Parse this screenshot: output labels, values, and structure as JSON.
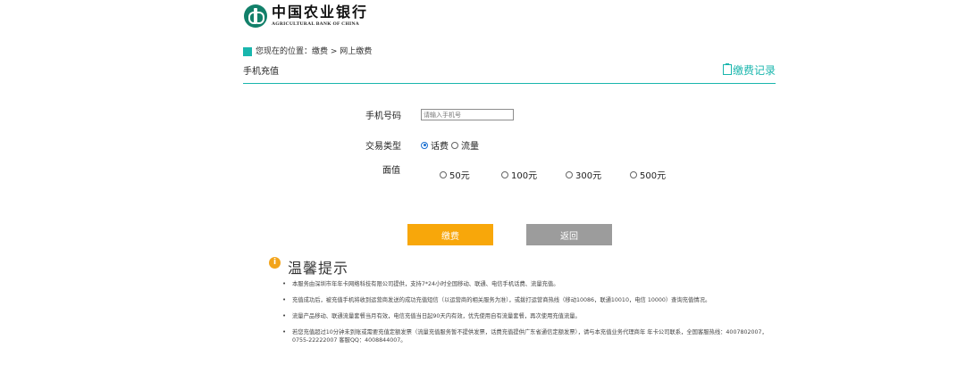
{
  "header": {
    "bank_name_cn": "中国农业银行",
    "bank_name_en": "AGRICULTURAL BANK OF CHINA"
  },
  "breadcrumb": {
    "prefix": "您现在的位置：",
    "items": [
      "缴费",
      "网上缴费"
    ],
    "separator": " > "
  },
  "page": {
    "title": "手机充值",
    "records_link": "缴费记录"
  },
  "form": {
    "phone": {
      "label": "手机号码",
      "value": "",
      "placeholder": "请输入手机号"
    },
    "type": {
      "label": "交易类型",
      "options": [
        {
          "label": "话费",
          "checked": true
        },
        {
          "label": "流量",
          "checked": false
        }
      ]
    },
    "amount": {
      "label": "面值",
      "options": [
        {
          "label": "50元",
          "checked": false
        },
        {
          "label": "100元",
          "checked": false
        },
        {
          "label": "300元",
          "checked": false
        },
        {
          "label": "500元",
          "checked": false
        }
      ]
    }
  },
  "buttons": {
    "pay": "缴费",
    "back": "返回"
  },
  "tips": {
    "title": "温馨提示",
    "items": [
      "本服务由深圳市年年卡网络科技有限公司提供，支持7*24小时全国移动、联通、电信手机话费、流量充值。",
      "充值成功后，被充值手机将收到运营商发送的成功充值短信（以运营商的相关服务为准），或拨打运营商热线（移动10086，联通10010，电信 10000）查询充值情况。",
      "流量产品移动、联通流量套餐当月有效，电信充值当日起90天内有效，优先使用自有流量套餐，再次使用充值流量。",
      "若您充值超过10分钟未到账或需要充值定额发票（流量充值服务暂不提供发票，话费充值提供广东省通信定额发票），请与本充值业务代理商年 年卡公司联系，全国客服热线：4007802007，0755-22222007 客服QQ：4008844007。"
    ]
  },
  "colors": {
    "accent": "#19b6ad",
    "pay_button": "#f8a70a",
    "back_button": "#9c9c9c",
    "logo": "#12806a",
    "tip_icon": "#f3a41a"
  }
}
